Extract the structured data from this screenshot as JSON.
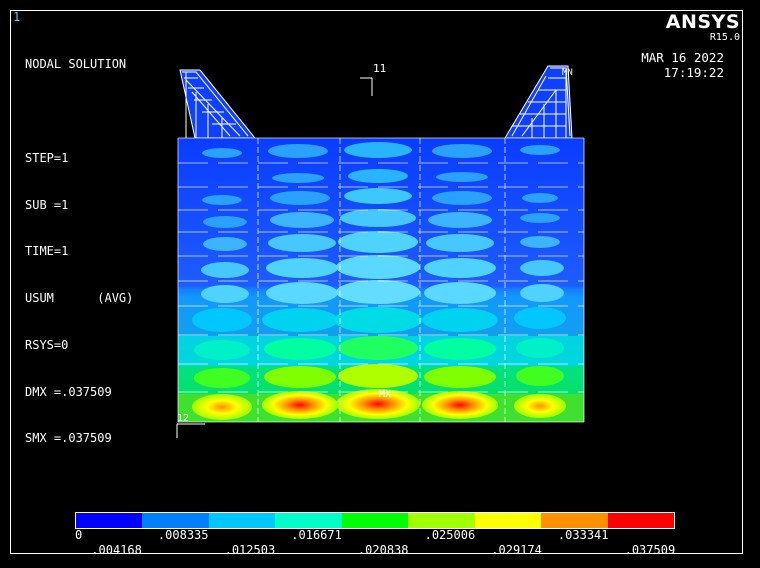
{
  "window_number": "1",
  "header_info": [
    "NODAL SOLUTION",
    "",
    "STEP=1",
    "SUB =1",
    "TIME=1",
    "USUM      (AVG)",
    "RSYS=0",
    "DMX =.037509",
    "SMX =.037509"
  ],
  "brand": {
    "name": "ANSYS",
    "version": "R15.0"
  },
  "datetime": {
    "date": "MAR 16 2022",
    "time": "17:19:22"
  },
  "labels": {
    "node_11": "11",
    "node_12": "12",
    "mn": "MN",
    "mx": "MX"
  },
  "legend": {
    "colors": [
      "#0000ff",
      "#0080ff",
      "#00c8ff",
      "#00ffc8",
      "#00ff00",
      "#a0ff00",
      "#ffff00",
      "#ff9000",
      "#ff0000"
    ],
    "top_ticks": [
      "0",
      ".008335",
      ".016671",
      ".025006",
      ".033341"
    ],
    "bottom_ticks": [
      ".004168",
      ".012503",
      ".020838",
      ".029174",
      ".037509"
    ]
  }
}
